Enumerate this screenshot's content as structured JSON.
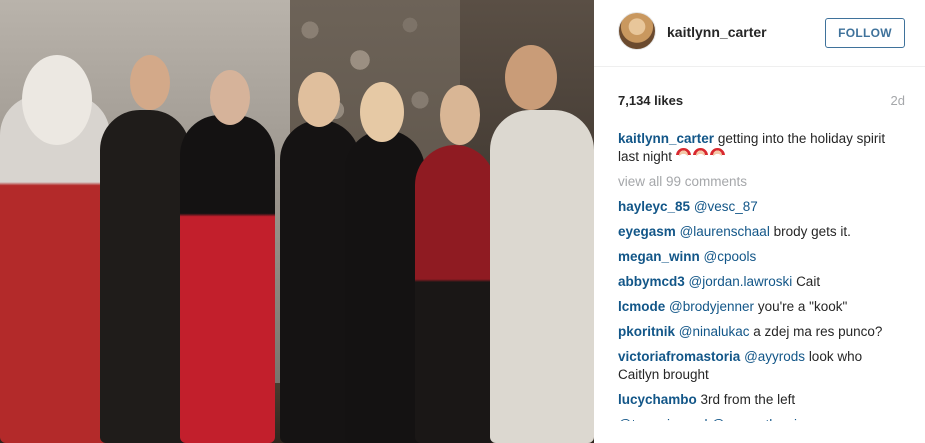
{
  "post": {
    "username": "kaitlynn_carter",
    "follow_label": "FOLLOW",
    "likes": "7,134 likes",
    "time_ago": "2d",
    "caption_user": "kaitlynn_carter",
    "caption_text": "getting into the holiday spirit last night",
    "caption_emoji": [
      "santa-emoji",
      "santa-emoji",
      "santa-emoji"
    ],
    "view_all": "view all 99 comments"
  },
  "comments": [
    {
      "user": "hayleyc_85",
      "mention": "@vesc_87",
      "text": ""
    },
    {
      "user": "eyegasm",
      "mention": "@laurenschaal",
      "text": "brody gets it."
    },
    {
      "user": "megan_winn",
      "mention": "@cpools",
      "text": ""
    },
    {
      "user": "abbymcd3",
      "mention": "@jordan.lawroski",
      "text": "Cait"
    },
    {
      "user": "lcmode",
      "mention": "@brodyjenner",
      "text": "you're a \"kook\""
    },
    {
      "user": "pkoritnik",
      "mention": "@ninalukac",
      "text": "a zdej ma res punco?"
    },
    {
      "user": "victoriafromastoria",
      "mention": "@ayyrods",
      "text": "look who Caitlyn brought"
    },
    {
      "user": "lucychambo",
      "mention": "",
      "text": "3rd from the left"
    },
    {
      "user": "",
      "mention": "@tay_wiegand @samanthawiese",
      "text": ""
    }
  ],
  "colors": {
    "link_blue": "#125688",
    "follow_blue": "#3f729b",
    "muted": "#a5a7aa"
  }
}
